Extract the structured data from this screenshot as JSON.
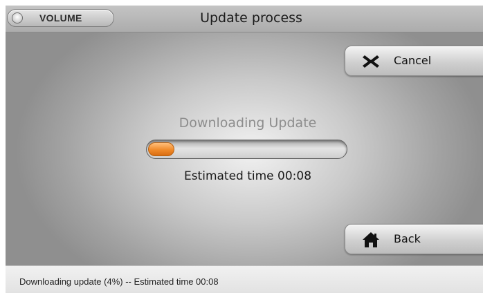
{
  "header": {
    "volume_label": "VOLUME",
    "title": "Update process"
  },
  "buttons": {
    "cancel": {
      "label": "Cancel",
      "icon": "close-x-icon"
    },
    "back": {
      "label": "Back",
      "icon": "home-icon"
    }
  },
  "progress": {
    "title": "Downloading Update",
    "percent": 4,
    "estimate_text": "Estimated time 00:08",
    "fill_color": "#f08a2a"
  },
  "status": {
    "text": "Downloading update (4%) -- Estimated time 00:08"
  }
}
